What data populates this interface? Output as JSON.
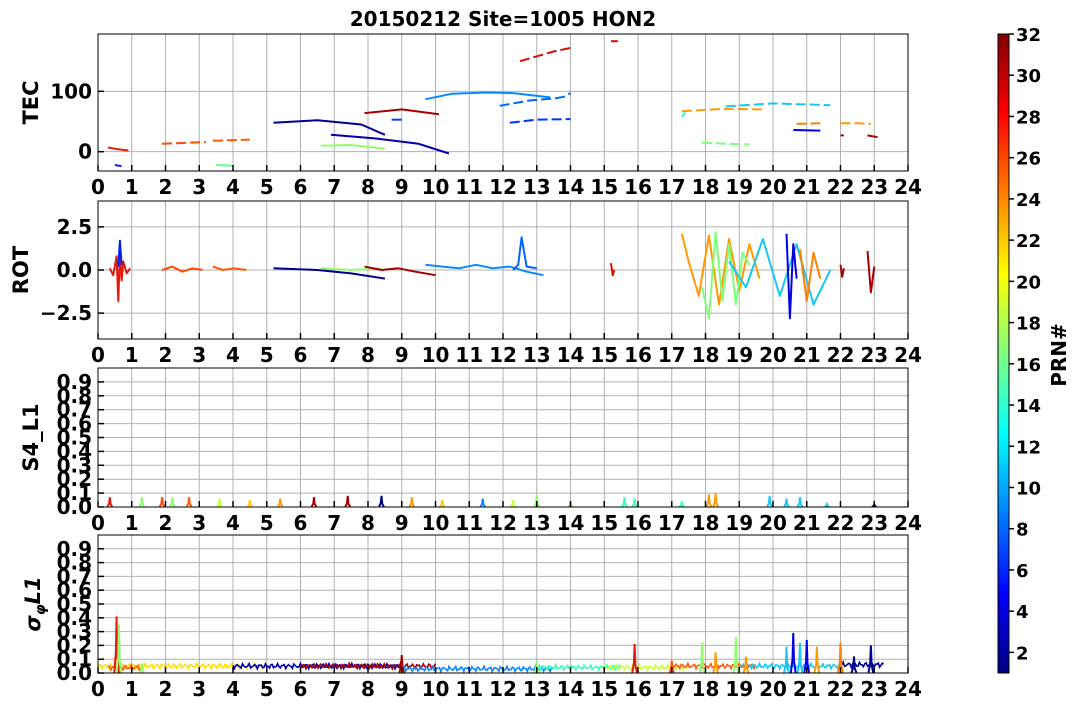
{
  "title": "20150212 Site=1005 HON2",
  "colorbar": {
    "label": "PRN#",
    "min": 1,
    "max": 32,
    "ticks": [
      2,
      4,
      6,
      8,
      10,
      12,
      14,
      16,
      18,
      20,
      22,
      24,
      26,
      28,
      30,
      32
    ],
    "colormap": "jet"
  },
  "chart_data": [
    {
      "type": "line",
      "ylabel": "TEC",
      "xlim": [
        0,
        24
      ],
      "ylim": [
        -32,
        195
      ],
      "xticks": [
        0,
        1,
        2,
        3,
        4,
        5,
        6,
        7,
        8,
        9,
        10,
        11,
        12,
        13,
        14,
        15,
        16,
        17,
        18,
        19,
        20,
        21,
        22,
        23,
        24
      ],
      "yticks": [
        0,
        100
      ],
      "grid": true,
      "series": [
        {
          "prn": 29,
          "color": "#e31a0b",
          "x": [
            0.3,
            0.6,
            0.9
          ],
          "y": [
            7,
            4,
            2
          ]
        },
        {
          "prn": 6,
          "color": "#0022ee",
          "x": [
            0.5,
            0.7
          ],
          "y": [
            -22,
            -24
          ]
        },
        {
          "prn": 27,
          "color": "#ff4a05",
          "x": [
            1.9,
            3.2
          ],
          "y": [
            13,
            16
          ],
          "dashed": true
        },
        {
          "prn": 27,
          "color": "#ff5a05",
          "x": [
            3.4,
            4.5
          ],
          "y": [
            18,
            20
          ],
          "dashed": true
        },
        {
          "prn": 17,
          "color": "#62ff94",
          "x": [
            3.5,
            4.0
          ],
          "y": [
            -22,
            -23
          ]
        },
        {
          "prn": 2,
          "color": "#000090",
          "x": [
            5.2,
            6.5,
            7.8,
            8.5
          ],
          "y": [
            48,
            52,
            45,
            28
          ]
        },
        {
          "prn": 3,
          "color": "#0000b0",
          "x": [
            6.9,
            8.2,
            9.5,
            10.4
          ],
          "y": [
            28,
            22,
            13,
            -3
          ]
        },
        {
          "prn": 19,
          "color": "#8eff6a",
          "x": [
            6.6,
            7.5,
            8.5
          ],
          "y": [
            10,
            11,
            5
          ]
        },
        {
          "prn": 31,
          "color": "#a60000",
          "x": [
            7.9,
            9.0,
            10.1
          ],
          "y": [
            64,
            70,
            62
          ]
        },
        {
          "prn": 6,
          "color": "#0044ff",
          "x": [
            8.7,
            9.0
          ],
          "y": [
            53,
            53
          ]
        },
        {
          "prn": 9,
          "color": "#0a88ff",
          "x": [
            9.7,
            10.5,
            11.5,
            12.3,
            13.4
          ],
          "y": [
            87,
            96,
            98,
            97,
            90
          ]
        },
        {
          "prn": 8,
          "color": "#0066ff",
          "x": [
            11.9,
            12.8,
            13.5,
            13.8,
            14.0
          ],
          "y": [
            76,
            85,
            88,
            91,
            97
          ],
          "dashed": true
        },
        {
          "prn": 5,
          "color": "#0033ff",
          "x": [
            12.2,
            13.0,
            14.0
          ],
          "y": [
            48,
            53,
            54
          ],
          "dashed": true
        },
        {
          "prn": 30,
          "color": "#d40f00",
          "x": [
            12.5,
            13.5,
            14.0
          ],
          "y": [
            150,
            166,
            172
          ],
          "dashed": true
        },
        {
          "prn": 30,
          "color": "#d40f00",
          "x": [
            15.2,
            15.4
          ],
          "y": [
            183,
            183
          ]
        },
        {
          "prn": 15,
          "color": "#38ffbe",
          "x": [
            17.3,
            17.4
          ],
          "y": [
            58,
            65
          ],
          "dashed": true
        },
        {
          "prn": 24,
          "color": "#ff9a00",
          "x": [
            17.3,
            18.5,
            19.8
          ],
          "y": [
            67,
            71,
            70
          ],
          "dashed": true
        },
        {
          "prn": 11,
          "color": "#18c8f0",
          "x": [
            18.6,
            20.0,
            21.7
          ],
          "y": [
            75,
            80,
            77
          ],
          "dashed": true
        },
        {
          "prn": 18,
          "color": "#7cff7a",
          "x": [
            17.9,
            18.6,
            19.3
          ],
          "y": [
            15,
            13,
            12
          ],
          "dashed": true
        },
        {
          "prn": 4,
          "color": "#0000e8",
          "x": [
            20.6,
            21.4
          ],
          "y": [
            36,
            35
          ]
        },
        {
          "prn": 25,
          "color": "#ff8000",
          "x": [
            20.7,
            21.4
          ],
          "y": [
            46,
            47
          ],
          "dashed": true
        },
        {
          "prn": 24,
          "color": "#ff9a00",
          "x": [
            22.0,
            22.5,
            22.9
          ],
          "y": [
            47,
            47,
            46
          ],
          "dashed": true
        },
        {
          "prn": 31,
          "color": "#a60000",
          "x": [
            22.0,
            22.1
          ],
          "y": [
            27,
            27
          ]
        },
        {
          "prn": 31,
          "color": "#a60000",
          "x": [
            22.8,
            23.1
          ],
          "y": [
            27,
            24
          ]
        }
      ]
    },
    {
      "type": "line",
      "ylabel": "ROT",
      "xlim": [
        0,
        24
      ],
      "ylim": [
        -4,
        4
      ],
      "xticks": [
        0,
        1,
        2,
        3,
        4,
        5,
        6,
        7,
        8,
        9,
        10,
        11,
        12,
        13,
        14,
        15,
        16,
        17,
        18,
        19,
        20,
        21,
        22,
        23,
        24
      ],
      "yticks": [
        -2.5,
        0.0,
        2.5
      ],
      "ytick_labels": [
        "−2.5",
        "0.0",
        "2.5"
      ],
      "grid": true,
      "series": [
        {
          "prn": 29,
          "color": "#e31a0b",
          "x": [
            0.35,
            0.45,
            0.55,
            0.6,
            0.65,
            0.7,
            0.75,
            0.85,
            0.95
          ],
          "y": [
            0.1,
            -0.3,
            0.8,
            -1.8,
            1.0,
            -0.6,
            0.5,
            -0.2,
            0.1
          ]
        },
        {
          "prn": 6,
          "color": "#0022ee",
          "x": [
            0.6,
            0.65,
            0.7
          ],
          "y": [
            0.2,
            1.7,
            0.3
          ]
        },
        {
          "prn": 27,
          "color": "#ff4a05",
          "x": [
            1.9,
            2.2,
            2.5,
            2.8,
            3.1
          ],
          "y": [
            0.0,
            0.2,
            -0.1,
            0.1,
            0.0
          ]
        },
        {
          "prn": 27,
          "color": "#ff5a05",
          "x": [
            3.4,
            3.7,
            4.0,
            4.4
          ],
          "y": [
            0.2,
            0.0,
            0.1,
            0.0
          ]
        },
        {
          "prn": 2,
          "color": "#000090",
          "x": [
            5.2,
            6.5,
            7.5,
            8.5
          ],
          "y": [
            0.1,
            0.0,
            -0.2,
            -0.5
          ]
        },
        {
          "prn": 19,
          "color": "#8eff6a",
          "x": [
            6.6,
            7.5,
            8.4
          ],
          "y": [
            0.1,
            0.0,
            0.1
          ]
        },
        {
          "prn": 31,
          "color": "#a60000",
          "x": [
            7.9,
            8.4,
            8.9,
            9.4,
            10.0
          ],
          "y": [
            0.2,
            0.0,
            0.1,
            -0.1,
            -0.3
          ]
        },
        {
          "prn": 9,
          "color": "#0a88ff",
          "x": [
            9.7,
            10.2,
            10.7,
            11.2,
            11.7,
            12.2,
            12.7,
            13.2
          ],
          "y": [
            0.3,
            0.2,
            0.1,
            0.3,
            0.1,
            0.2,
            -0.1,
            -0.3
          ]
        },
        {
          "prn": 8,
          "color": "#0066ff",
          "x": [
            12.3,
            12.45,
            12.55,
            12.7,
            13.0
          ],
          "y": [
            0.0,
            0.3,
            1.9,
            0.2,
            0.1
          ]
        },
        {
          "prn": 30,
          "color": "#d40f00",
          "x": [
            15.2,
            15.25,
            15.3
          ],
          "y": [
            0.4,
            -0.3,
            0.0
          ]
        },
        {
          "prn": 24,
          "color": "#ff9a00",
          "x": [
            17.3,
            17.5,
            17.8,
            18.1,
            18.4,
            18.7,
            19.0,
            19.3,
            19.6
          ],
          "y": [
            2.1,
            0.5,
            -1.5,
            2.0,
            -2.0,
            1.8,
            -1.2,
            1.5,
            -0.5
          ]
        },
        {
          "prn": 18,
          "color": "#7cff7a",
          "x": [
            17.9,
            18.1,
            18.3,
            18.5,
            18.7,
            18.9,
            19.1,
            19.3
          ],
          "y": [
            -1.0,
            -2.8,
            2.2,
            -1.8,
            1.5,
            -2.0,
            1.0,
            0.3
          ]
        },
        {
          "prn": 11,
          "color": "#18c8f0",
          "x": [
            18.7,
            19.2,
            19.7,
            20.2,
            20.7,
            21.2,
            21.7
          ],
          "y": [
            0.5,
            -1.0,
            1.8,
            -1.5,
            1.5,
            -2.0,
            0.0
          ]
        },
        {
          "prn": 4,
          "color": "#0000e8",
          "x": [
            20.4,
            20.5,
            20.6,
            20.7
          ],
          "y": [
            2.1,
            -2.8,
            1.5,
            -0.5
          ]
        },
        {
          "prn": 25,
          "color": "#ff8000",
          "x": [
            20.8,
            21.0,
            21.2,
            21.4
          ],
          "y": [
            1.2,
            -1.8,
            1.0,
            -0.5
          ]
        },
        {
          "prn": 31,
          "color": "#a60000",
          "x": [
            22.0,
            22.05,
            22.1
          ],
          "y": [
            0.3,
            -0.4,
            0.1
          ]
        },
        {
          "prn": 31,
          "color": "#a60000",
          "x": [
            22.8,
            22.9,
            23.0
          ],
          "y": [
            1.1,
            -1.3,
            0.2
          ]
        }
      ]
    },
    {
      "type": "line",
      "ylabel": "S4_L1",
      "xlim": [
        0,
        24
      ],
      "ylim": [
        0,
        1
      ],
      "xticks": [
        0,
        1,
        2,
        3,
        4,
        5,
        6,
        7,
        8,
        9,
        10,
        11,
        12,
        13,
        14,
        15,
        16,
        17,
        18,
        19,
        20,
        21,
        22,
        23,
        24
      ],
      "yticks": [
        0.0,
        0.1,
        0.2,
        0.3,
        0.4,
        0.5,
        0.6,
        0.7,
        0.8,
        0.9
      ],
      "ytick_labels": [
        "0.0",
        "0.1",
        "0.2",
        "0.3",
        "0.4",
        "0.5",
        "0.6",
        "0.7",
        "0.8",
        "0.9"
      ],
      "grid": true,
      "spikes": [
        {
          "x": 0.35,
          "y": 0.07,
          "color": "#e31a0b"
        },
        {
          "x": 1.3,
          "y": 0.07,
          "color": "#8eff6a"
        },
        {
          "x": 1.9,
          "y": 0.07,
          "color": "#ff4a05"
        },
        {
          "x": 2.2,
          "y": 0.07,
          "color": "#8eff6a"
        },
        {
          "x": 2.7,
          "y": 0.07,
          "color": "#ff5a05"
        },
        {
          "x": 3.6,
          "y": 0.06,
          "color": "#c8ff38"
        },
        {
          "x": 4.5,
          "y": 0.05,
          "color": "#ffcc00"
        },
        {
          "x": 5.4,
          "y": 0.06,
          "color": "#ff9a00"
        },
        {
          "x": 6.4,
          "y": 0.07,
          "color": "#a60000"
        },
        {
          "x": 7.4,
          "y": 0.08,
          "color": "#a60000"
        },
        {
          "x": 8.4,
          "y": 0.08,
          "color": "#000090"
        },
        {
          "x": 9.3,
          "y": 0.07,
          "color": "#ff9a00"
        },
        {
          "x": 10.2,
          "y": 0.05,
          "color": "#ffcc00"
        },
        {
          "x": 11.4,
          "y": 0.06,
          "color": "#0a88ff"
        },
        {
          "x": 12.3,
          "y": 0.05,
          "color": "#c8ff38"
        },
        {
          "x": 13.0,
          "y": 0.09,
          "color": "#8eff6a"
        },
        {
          "x": 14.0,
          "y": 0.04,
          "color": "#8eff6a"
        },
        {
          "x": 15.6,
          "y": 0.07,
          "color": "#38ffbe"
        },
        {
          "x": 15.9,
          "y": 0.06,
          "color": "#38ffbe"
        },
        {
          "x": 17.3,
          "y": 0.04,
          "color": "#38ffbe"
        },
        {
          "x": 18.1,
          "y": 0.09,
          "color": "#ff9a00"
        },
        {
          "x": 18.3,
          "y": 0.1,
          "color": "#ff9a00"
        },
        {
          "x": 19.9,
          "y": 0.08,
          "color": "#18c8f0"
        },
        {
          "x": 20.4,
          "y": 0.06,
          "color": "#18c8f0"
        },
        {
          "x": 20.8,
          "y": 0.07,
          "color": "#18c8f0"
        },
        {
          "x": 21.6,
          "y": 0.02,
          "color": "#18c8f0"
        },
        {
          "x": 23.0,
          "y": 0.02,
          "color": "#000090"
        }
      ]
    },
    {
      "type": "line",
      "ylabel": "σφL1",
      "xlim": [
        0,
        24
      ],
      "ylim": [
        0,
        1
      ],
      "xticks": [
        0,
        1,
        2,
        3,
        4,
        5,
        6,
        7,
        8,
        9,
        10,
        11,
        12,
        13,
        14,
        15,
        16,
        17,
        18,
        19,
        20,
        21,
        22,
        23,
        24
      ],
      "yticks": [
        0.0,
        0.1,
        0.2,
        0.3,
        0.4,
        0.5,
        0.6,
        0.7,
        0.8,
        0.9
      ],
      "ytick_labels": [
        "0.0",
        "0.1",
        "0.2",
        "0.3",
        "0.4",
        "0.5",
        "0.6",
        "0.7",
        "0.8",
        "0.9"
      ],
      "grid": true,
      "baseline_series": [
        {
          "color": "#ffe000",
          "x0": 0.0,
          "x1": 5.0,
          "level": 0.05
        },
        {
          "color": "#ff5a05",
          "x0": 0.3,
          "x1": 1.3,
          "level": 0.04
        },
        {
          "color": "#0000b0",
          "x0": 4.0,
          "x1": 9.0,
          "level": 0.05
        },
        {
          "color": "#a60000",
          "x0": 6.0,
          "x1": 10.0,
          "level": 0.05
        },
        {
          "color": "#0a88ff",
          "x0": 9.0,
          "x1": 13.5,
          "level": 0.03
        },
        {
          "color": "#38ffbe",
          "x0": 13.0,
          "x1": 15.5,
          "level": 0.04
        },
        {
          "color": "#c8ff38",
          "x0": 15.0,
          "x1": 17.5,
          "level": 0.04
        },
        {
          "color": "#ff5a05",
          "x0": 17.0,
          "x1": 19.5,
          "level": 0.05
        },
        {
          "color": "#18c8f0",
          "x0": 19.0,
          "x1": 22.0,
          "level": 0.05
        },
        {
          "color": "#000090",
          "x0": 22.0,
          "x1": 23.3,
          "level": 0.06
        }
      ],
      "spikes": [
        {
          "x": 0.55,
          "y": 0.41,
          "color": "#e31a0b"
        },
        {
          "x": 0.62,
          "y": 0.35,
          "color": "#8eff6a"
        },
        {
          "x": 1.3,
          "y": 0.07,
          "color": "#8eff6a"
        },
        {
          "x": 9.0,
          "y": 0.13,
          "color": "#a60000"
        },
        {
          "x": 13.0,
          "y": 0.09,
          "color": "#8eff6a"
        },
        {
          "x": 15.9,
          "y": 0.21,
          "color": "#e31a0b"
        },
        {
          "x": 17.0,
          "y": 0.09,
          "color": "#ff5a05"
        },
        {
          "x": 17.9,
          "y": 0.22,
          "color": "#8eff6a"
        },
        {
          "x": 18.3,
          "y": 0.15,
          "color": "#ff9a00"
        },
        {
          "x": 18.9,
          "y": 0.26,
          "color": "#8eff6a"
        },
        {
          "x": 19.2,
          "y": 0.12,
          "color": "#ff9a00"
        },
        {
          "x": 20.4,
          "y": 0.19,
          "color": "#18c8f0"
        },
        {
          "x": 20.6,
          "y": 0.29,
          "color": "#0000e8"
        },
        {
          "x": 20.8,
          "y": 0.22,
          "color": "#18c8f0"
        },
        {
          "x": 21.0,
          "y": 0.24,
          "color": "#0000e8"
        },
        {
          "x": 21.3,
          "y": 0.19,
          "color": "#ff9a00"
        },
        {
          "x": 22.0,
          "y": 0.22,
          "color": "#ff8000"
        },
        {
          "x": 22.4,
          "y": 0.12,
          "color": "#000090"
        },
        {
          "x": 22.9,
          "y": 0.2,
          "color": "#000090"
        }
      ]
    }
  ]
}
